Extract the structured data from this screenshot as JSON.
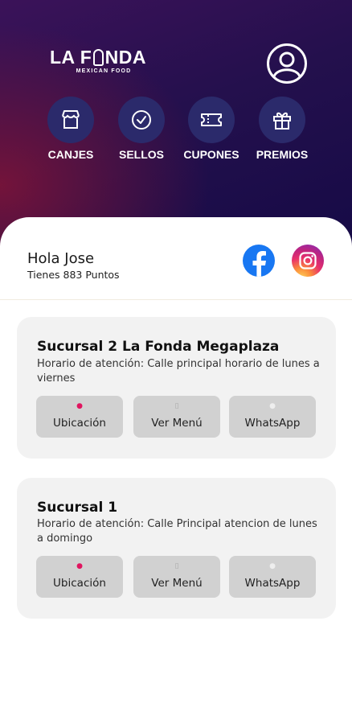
{
  "brand": {
    "name_part1": "LA F",
    "name_part2": "NDA",
    "tagline": "MEXICAN FOOD"
  },
  "nav": [
    {
      "label": "CANJES",
      "icon": "store-icon"
    },
    {
      "label": "SELLOS",
      "icon": "check-circle-icon"
    },
    {
      "label": "CUPONES",
      "icon": "ticket-icon"
    },
    {
      "label": "PREMIOS",
      "icon": "gift-icon"
    }
  ],
  "greeting": {
    "hello": "Hola Jose",
    "points": "Tienes 883 Puntos"
  },
  "social": {
    "facebook_icon": "facebook-icon",
    "instagram_icon": "instagram-icon"
  },
  "branches": [
    {
      "name": "Sucursal 2 La Fonda Megaplaza",
      "description": "Horario de atención: Calle principal horario de lunes a viernes",
      "buttons": [
        "Ubicación",
        "Ver Menú",
        "WhatsApp"
      ]
    },
    {
      "name": "Sucursal 1",
      "description": "Horario de atención: Calle Principal atencion de lunes a domingo",
      "buttons": [
        "Ubicación",
        "Ver Menú",
        "WhatsApp"
      ]
    }
  ],
  "colors": {
    "hero_top": "#3b1259",
    "hero_bottom": "#150a46",
    "nav_circle": "#2b2a6b",
    "card_bg": "#f2f2f2",
    "button_bg": "#d1d1d1",
    "facebook": "#1877f2"
  }
}
